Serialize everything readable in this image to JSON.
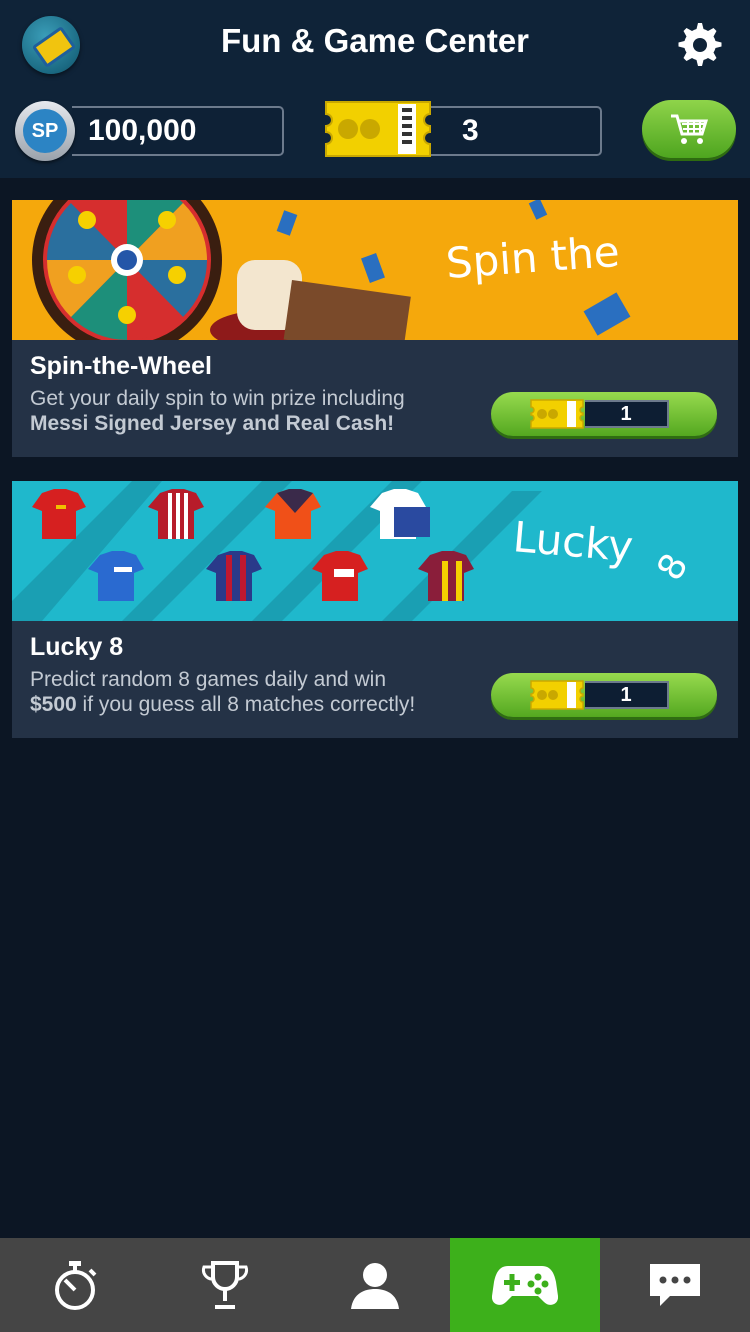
{
  "header": {
    "title": "Fun & Game Center",
    "sp_badge_label": "SP",
    "coins": "100,000",
    "tickets": "3"
  },
  "games": [
    {
      "banner_text": "Spin the",
      "name": "Spin-the-Wheel",
      "description_line1": "Get your daily spin to win prize including",
      "description_line2": "Messi Signed Jersey and Real Cash!",
      "cost": "1",
      "banner_color": "#f5a80c"
    },
    {
      "banner_text": "Lucky",
      "banner_text_2": "8",
      "name": "Lucky 8",
      "description_line1": "Predict random 8 games daily and win",
      "description_bold": "$500",
      "description_line2_rest": " if you guess all 8 matches correctly!",
      "cost": "1",
      "banner_color": "#1fb8cc"
    }
  ],
  "nav": {
    "tabs": [
      {
        "icon": "stopwatch-icon"
      },
      {
        "icon": "trophy-icon"
      },
      {
        "icon": "profile-icon"
      },
      {
        "icon": "gamepad-icon",
        "active": true
      },
      {
        "icon": "chat-icon"
      }
    ],
    "active_color": "#3db01b"
  }
}
